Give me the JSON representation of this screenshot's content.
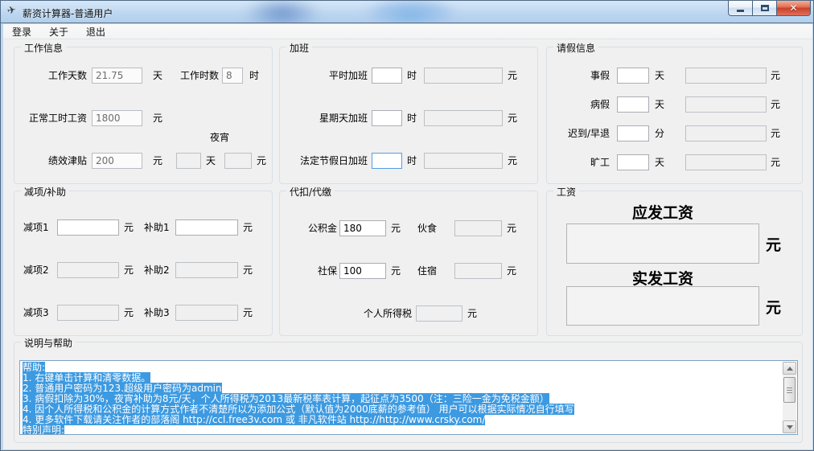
{
  "window": {
    "title": "薪资计算器-普通用户"
  },
  "menu": {
    "login": "登录",
    "about": "关于",
    "exit": "退出"
  },
  "work_info": {
    "title": "工作信息",
    "work_days": {
      "label": "工作天数",
      "value": "21.75",
      "unit": "天"
    },
    "work_hours": {
      "label": "工作时数",
      "value": "8",
      "unit": "时"
    },
    "normal_wage": {
      "label": "正常工时工资",
      "value": "1800",
      "unit": "元"
    },
    "performance": {
      "label": "绩效津贴",
      "value": "200",
      "unit": "元"
    },
    "night_snack": {
      "label": "夜宵",
      "days_unit": "天",
      "amount_unit": "元"
    }
  },
  "overtime": {
    "title": "加班",
    "rows": [
      {
        "label": "平时加班",
        "hours_unit": "时",
        "amount_unit": "元"
      },
      {
        "label": "星期天加班",
        "hours_unit": "时",
        "amount_unit": "元"
      },
      {
        "label": "法定节假日加班",
        "hours_unit": "时",
        "amount_unit": "元"
      }
    ]
  },
  "leave": {
    "title": "请假信息",
    "rows": [
      {
        "label": "事假",
        "unit": "天",
        "amount_unit": "元"
      },
      {
        "label": "病假",
        "unit": "天",
        "amount_unit": "元"
      },
      {
        "label": "迟到/早退",
        "unit": "分",
        "amount_unit": "元"
      },
      {
        "label": "旷工",
        "unit": "天",
        "amount_unit": "元"
      }
    ]
  },
  "adjustments": {
    "title": "减项/补助",
    "rows": [
      {
        "minus_label": "减项1",
        "minus_unit": "元",
        "plus_label": "补助1",
        "plus_unit": "元"
      },
      {
        "minus_label": "减项2",
        "minus_unit": "元",
        "plus_label": "补助2",
        "plus_unit": "元"
      },
      {
        "minus_label": "减项3",
        "minus_unit": "元",
        "plus_label": "补助3",
        "plus_unit": "元"
      }
    ]
  },
  "withholding": {
    "title": "代扣/代缴",
    "rows": [
      {
        "left_label": "公积金",
        "left_value": "180",
        "left_unit": "元",
        "right_label": "伙食",
        "right_unit": "元"
      },
      {
        "left_label": "社保",
        "left_value": "100",
        "left_unit": "元",
        "right_label": "住宿",
        "right_unit": "元"
      }
    ],
    "tax": {
      "label": "个人所得税",
      "unit": "元"
    }
  },
  "salary": {
    "title": "工资",
    "gross": {
      "label": "应发工资",
      "unit": "元",
      "value": ""
    },
    "net": {
      "label": "实发工资",
      "unit": "元",
      "value": ""
    }
  },
  "help": {
    "title": "说明与帮助",
    "lines": [
      "帮助:",
      "1. 右键单击计算和清零数据。",
      "2. 普通用户密码为123.超级用户密码为admin",
      "3. 病假扣除为30%，夜宵补助为8元/天，个人所得税为2013最新税率表计算，起征点为3500（注：三险一金为免税金额）",
      "4. 因个人所得税和公积金的计算方式作者不清楚所以为添加公式（默认值为2000底薪的参考值） 用户可以根据实际情况自行填写",
      "4. 更多软件下载请关注作者的部落阁 http://ccl.free3v.com 或 非凡软件站 http://http://www.crsky.com/",
      "特别声明:"
    ]
  },
  "colors": {
    "selection": "#3d9ae1",
    "close_button": "#c8402a",
    "titlebar": "#bcd6f0"
  }
}
